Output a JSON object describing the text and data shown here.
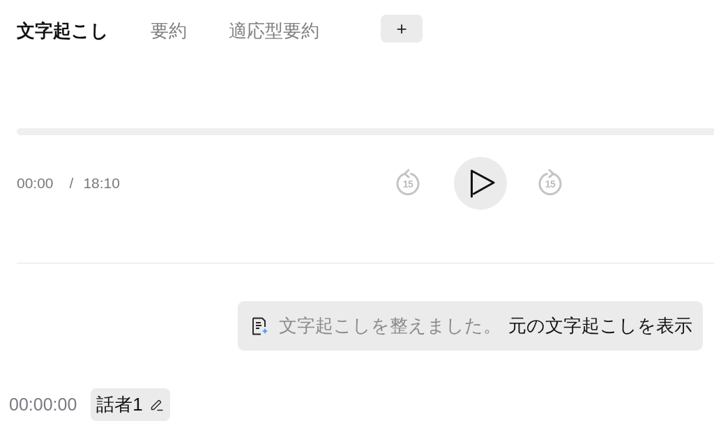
{
  "tabs": [
    {
      "label": "文字起こし",
      "selected": true
    },
    {
      "label": "要約",
      "selected": false
    },
    {
      "label": "適応型要約",
      "selected": false
    }
  ],
  "add_tab_button": {
    "label": "+"
  },
  "player": {
    "current_time": "00:00",
    "separator": "/",
    "duration": "18:10",
    "skip_back": {
      "label": "15"
    },
    "playing": false,
    "skip_forward": {
      "label": "15"
    }
  },
  "notice": {
    "message": "文字起こしを整えました。",
    "link": "元の文字起こしを表示"
  },
  "transcript": [
    {
      "timestamp": "00:00:00",
      "speaker": "話者1"
    }
  ]
}
